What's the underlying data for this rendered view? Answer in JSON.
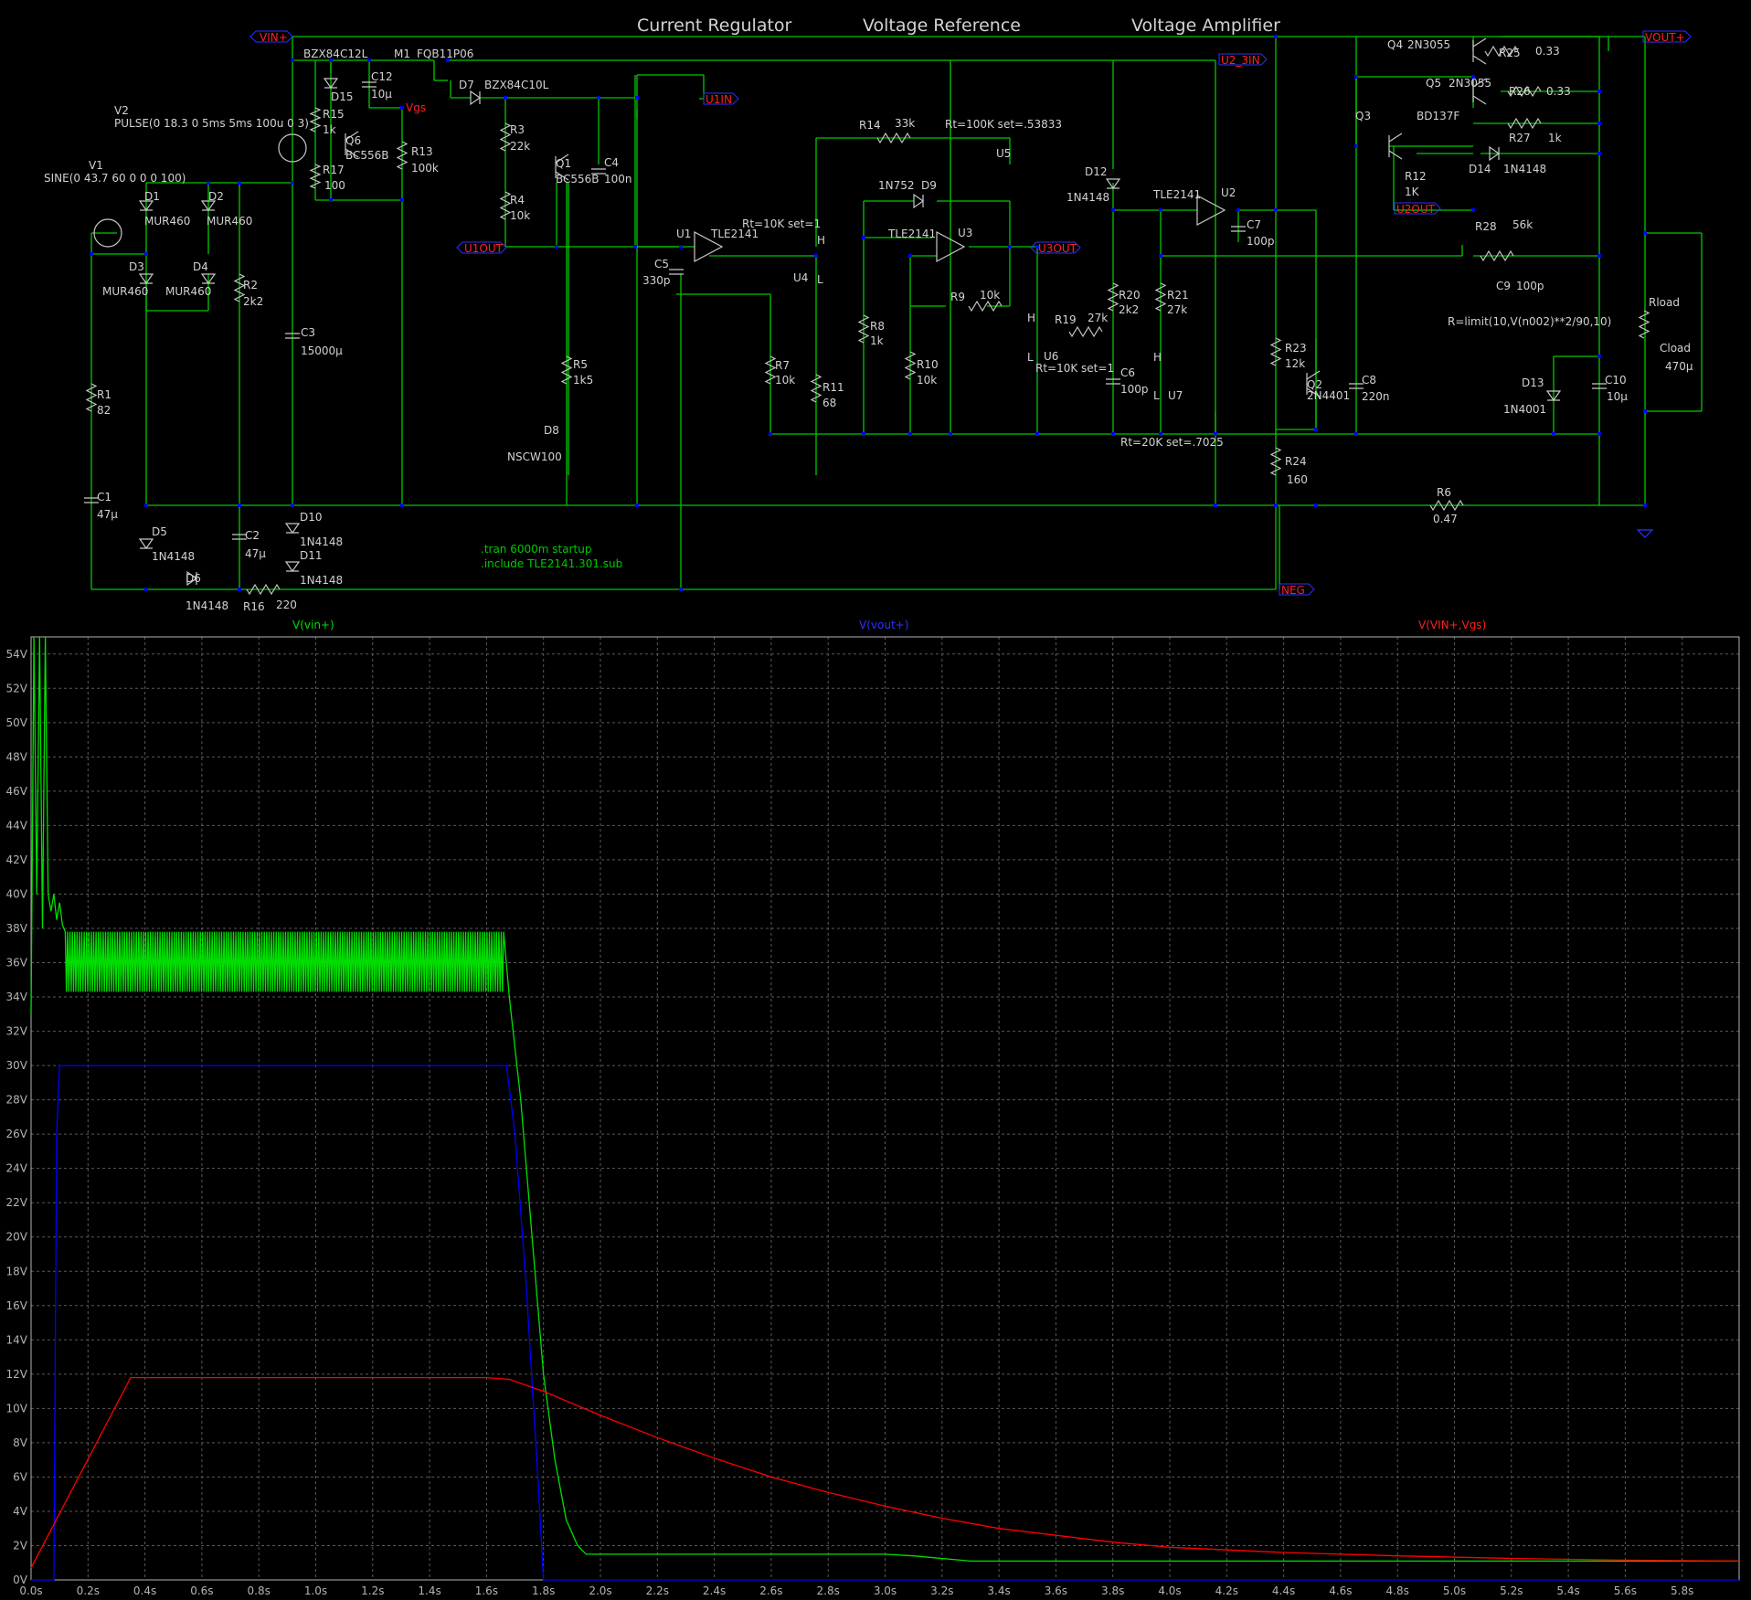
{
  "schematic": {
    "titles": {
      "current_regulator": "Current Regulator",
      "voltage_reference": "Voltage Reference",
      "voltage_amplifier": "Voltage Amplifier"
    },
    "net_labels": {
      "vin": "VIN+",
      "vout": "VOUT+",
      "neg": "NEG",
      "u1in": "U1IN",
      "u1out": "U1OUT",
      "u2_3in": "U2_3IN",
      "u2out": "U2OUT",
      "u3out": "U3OUT",
      "vgs": "Vgs"
    },
    "sources": {
      "v1_name": "V1",
      "v1_value": "SINE(0 43.7 60 0 0 0 100)",
      "v2_name": "V2",
      "v2_value": "PULSE(0 18.3 0 5ms 5ms 100u 0 3)"
    },
    "parts": {
      "d1": "D1",
      "d1_model": "MUR460",
      "d2": "D2",
      "d2_model": "MUR460",
      "d3": "D3",
      "d3_model": "MUR460",
      "d4": "D4",
      "d4_model": "MUR460",
      "r1": "R1",
      "r1_value": "82",
      "c1": "C1",
      "c1_value": "47µ",
      "d5": "D5",
      "d5_model": "1N4148",
      "d6": "D6",
      "d6_model": "1N4148",
      "r2": "R2",
      "r2_value": "2k2",
      "c2": "C2",
      "c2_value": "47µ",
      "r16": "R16",
      "r16_value": "220",
      "c3": "C3",
      "c3_value": "15000µ",
      "d10": "D10",
      "d10_model": "1N4148",
      "d11": "D11",
      "d11_model": "1N4148",
      "d15_model": "BZX84C12L",
      "d15": "D15",
      "r15": "R15",
      "r15_value": "1k",
      "r17": "R17",
      "r17_value": "100",
      "q6": "Q6",
      "q6_model": "BC556B",
      "c12": "C12",
      "c12_value": "10µ",
      "m1": "M1",
      "m1_model": "FQB11P06",
      "r13": "R13",
      "r13_value": "100k",
      "d7": "D7",
      "d7_model": "BZX84C10L",
      "r3": "R3",
      "r3_value": "22k",
      "r4": "R4",
      "r4_value": "10k",
      "q1": "Q1",
      "q1_model": "BC556B",
      "c4": "C4",
      "c4_value": "100n",
      "r5": "R5",
      "r5_value": "1k5",
      "d8": "D8",
      "d8_model": "NSCW100",
      "u1": "U1",
      "u1_model": "TLE2141",
      "c5": "C5",
      "c5_value": "330p",
      "r7": "R7",
      "r7_value": "10k",
      "u4": "U4",
      "u4_param": "Rt=10K set=1",
      "r11": "R11",
      "r11_value": "68",
      "r14": "R14",
      "r14_value": "33k",
      "u5": "U5",
      "u5_param": "Rt=100K set=.53833",
      "d9_model": "1N752",
      "d9": "D9",
      "u3_model": "TLE2141",
      "u3": "U3",
      "r8": "R8",
      "r8_value": "1k",
      "r9": "R9",
      "r9_value": "10k",
      "r10": "R10",
      "r10_value": "10k",
      "u6": "U6",
      "u6_param": "Rt=10K set=1",
      "r19": "R19",
      "r19_value": "27k",
      "d12": "D12",
      "d12_model": "1N4148",
      "r20": "R20",
      "r20_value": "2k2",
      "c6": "C6",
      "c6_value": "100p",
      "u2_model": "TLE2141",
      "u2": "U2",
      "r21": "R21",
      "r21_value": "27k",
      "u7": "U7",
      "u7_param": "Rt=20K set=.7025",
      "c7": "C7",
      "c7_value": "100p",
      "r23": "R23",
      "r23_value": "12k",
      "q2": "Q2",
      "q2_model": "2N4401",
      "r24": "R24",
      "r24_value": "160",
      "c8": "C8",
      "c8_value": "220n",
      "q3": "Q3",
      "q3_model": "BD137F",
      "r12": "R12",
      "r12_value": "1K",
      "d14": "D14",
      "d14_model": "1N4148",
      "q4": "Q4",
      "q4_model": "2N3055",
      "r25": "R25",
      "r25_value": "0.33",
      "q5": "Q5",
      "q5_model": "2N3055",
      "r26": "R26",
      "r26_value": "0.33",
      "r27": "R27",
      "r27_value": "1k",
      "r28": "R28",
      "r28_value": "56k",
      "c9": "C9",
      "c9_value": "100p",
      "rload": "Rload",
      "rload_expr": "R=limit(10,V(n002)**2/90,10)",
      "cload": "Cload",
      "cload_value": "470µ",
      "d13": "D13",
      "d13_model": "1N4001",
      "c10": "C10",
      "c10_value": "10µ",
      "r6": "R6",
      "r6_value": "0.47",
      "pot_h": "H",
      "pot_l": "L"
    },
    "directives": {
      "tran": ".tran 6000m startup",
      "include": ".include TLE2141.301.sub"
    }
  },
  "plot": {
    "colors": {
      "background": "#000000",
      "grid": "#5a5a5a",
      "axis_text": "#b4b4b4",
      "vin": "#00e000",
      "vout": "#0000ff",
      "vgs": "#ff0000",
      "wire": "#00c800",
      "junction": "#0000ff",
      "net_label": "#ff0000"
    },
    "traces": {
      "vin": "V(vin+)",
      "vout": "V(vout+)",
      "vgs": "V(VIN+,Vgs)"
    },
    "y_ticks": [
      "0V",
      "2V",
      "4V",
      "6V",
      "8V",
      "10V",
      "12V",
      "14V",
      "16V",
      "18V",
      "20V",
      "22V",
      "24V",
      "26V",
      "28V",
      "30V",
      "32V",
      "34V",
      "36V",
      "38V",
      "40V",
      "42V",
      "44V",
      "46V",
      "48V",
      "50V",
      "52V",
      "54V"
    ],
    "x_ticks": [
      "0.0s",
      "0.2s",
      "0.4s",
      "0.6s",
      "0.8s",
      "1.0s",
      "1.2s",
      "1.4s",
      "1.6s",
      "1.8s",
      "2.0s",
      "2.2s",
      "2.4s",
      "2.6s",
      "2.8s",
      "3.0s",
      "3.2s",
      "3.4s",
      "3.6s",
      "3.8s",
      "4.0s",
      "4.2s",
      "4.4s",
      "4.6s",
      "4.8s",
      "5.0s",
      "5.2s",
      "5.4s",
      "5.6s",
      "5.8s"
    ]
  },
  "chart_data": {
    "type": "line",
    "xlabel": "",
    "ylabel": "",
    "xlim": [
      0,
      6.0
    ],
    "ylim": [
      0,
      55
    ],
    "grid": true,
    "series": [
      {
        "name": "V(vin+)",
        "points": [
          [
            0.0,
            33
          ],
          [
            0.01,
            55
          ],
          [
            0.02,
            40
          ],
          [
            0.03,
            55
          ],
          [
            0.04,
            38
          ],
          [
            0.05,
            55
          ],
          [
            0.06,
            40
          ],
          [
            0.07,
            39
          ],
          [
            0.08,
            40
          ],
          [
            0.09,
            38.5
          ],
          [
            0.1,
            39.5
          ],
          [
            0.11,
            38.2
          ],
          [
            0.12,
            37
          ],
          [
            0.14,
            36
          ],
          [
            1.66,
            36
          ],
          [
            1.68,
            34
          ],
          [
            1.72,
            28
          ],
          [
            1.76,
            20
          ],
          [
            1.8,
            12
          ],
          [
            1.84,
            7
          ],
          [
            1.88,
            3.5
          ],
          [
            1.92,
            2
          ],
          [
            1.95,
            1.5
          ],
          [
            2.2,
            1.5
          ],
          [
            3.0,
            1.5
          ],
          [
            3.1,
            1.4
          ],
          [
            3.3,
            1.1
          ],
          [
            6.0,
            1.1
          ]
        ],
        "ripple": {
          "from": 0.12,
          "to": 1.66,
          "min": 34.3,
          "max": 37.8,
          "cycles_per_second": 120
        }
      },
      {
        "name": "V(vout+)",
        "points": [
          [
            0.0,
            0
          ],
          [
            0.08,
            0
          ],
          [
            0.09,
            26
          ],
          [
            0.1,
            30
          ],
          [
            1.67,
            30
          ],
          [
            1.7,
            26
          ],
          [
            1.74,
            17
          ],
          [
            1.78,
            6
          ],
          [
            1.8,
            0
          ],
          [
            6.0,
            0
          ]
        ]
      },
      {
        "name": "V(VIN+,Vgs)",
        "points": [
          [
            0.0,
            0.7
          ],
          [
            0.35,
            11.8
          ],
          [
            1.6,
            11.8
          ],
          [
            1.68,
            11.7
          ],
          [
            1.8,
            11.0
          ],
          [
            2.0,
            9.6
          ],
          [
            2.2,
            8.3
          ],
          [
            2.4,
            7.1
          ],
          [
            2.6,
            6.0
          ],
          [
            2.8,
            5.1
          ],
          [
            3.0,
            4.3
          ],
          [
            3.2,
            3.6
          ],
          [
            3.4,
            3.0
          ],
          [
            3.6,
            2.6
          ],
          [
            3.8,
            2.2
          ],
          [
            4.0,
            1.9
          ],
          [
            4.4,
            1.6
          ],
          [
            4.8,
            1.4
          ],
          [
            5.2,
            1.25
          ],
          [
            5.6,
            1.15
          ],
          [
            6.0,
            1.1
          ]
        ]
      }
    ]
  }
}
